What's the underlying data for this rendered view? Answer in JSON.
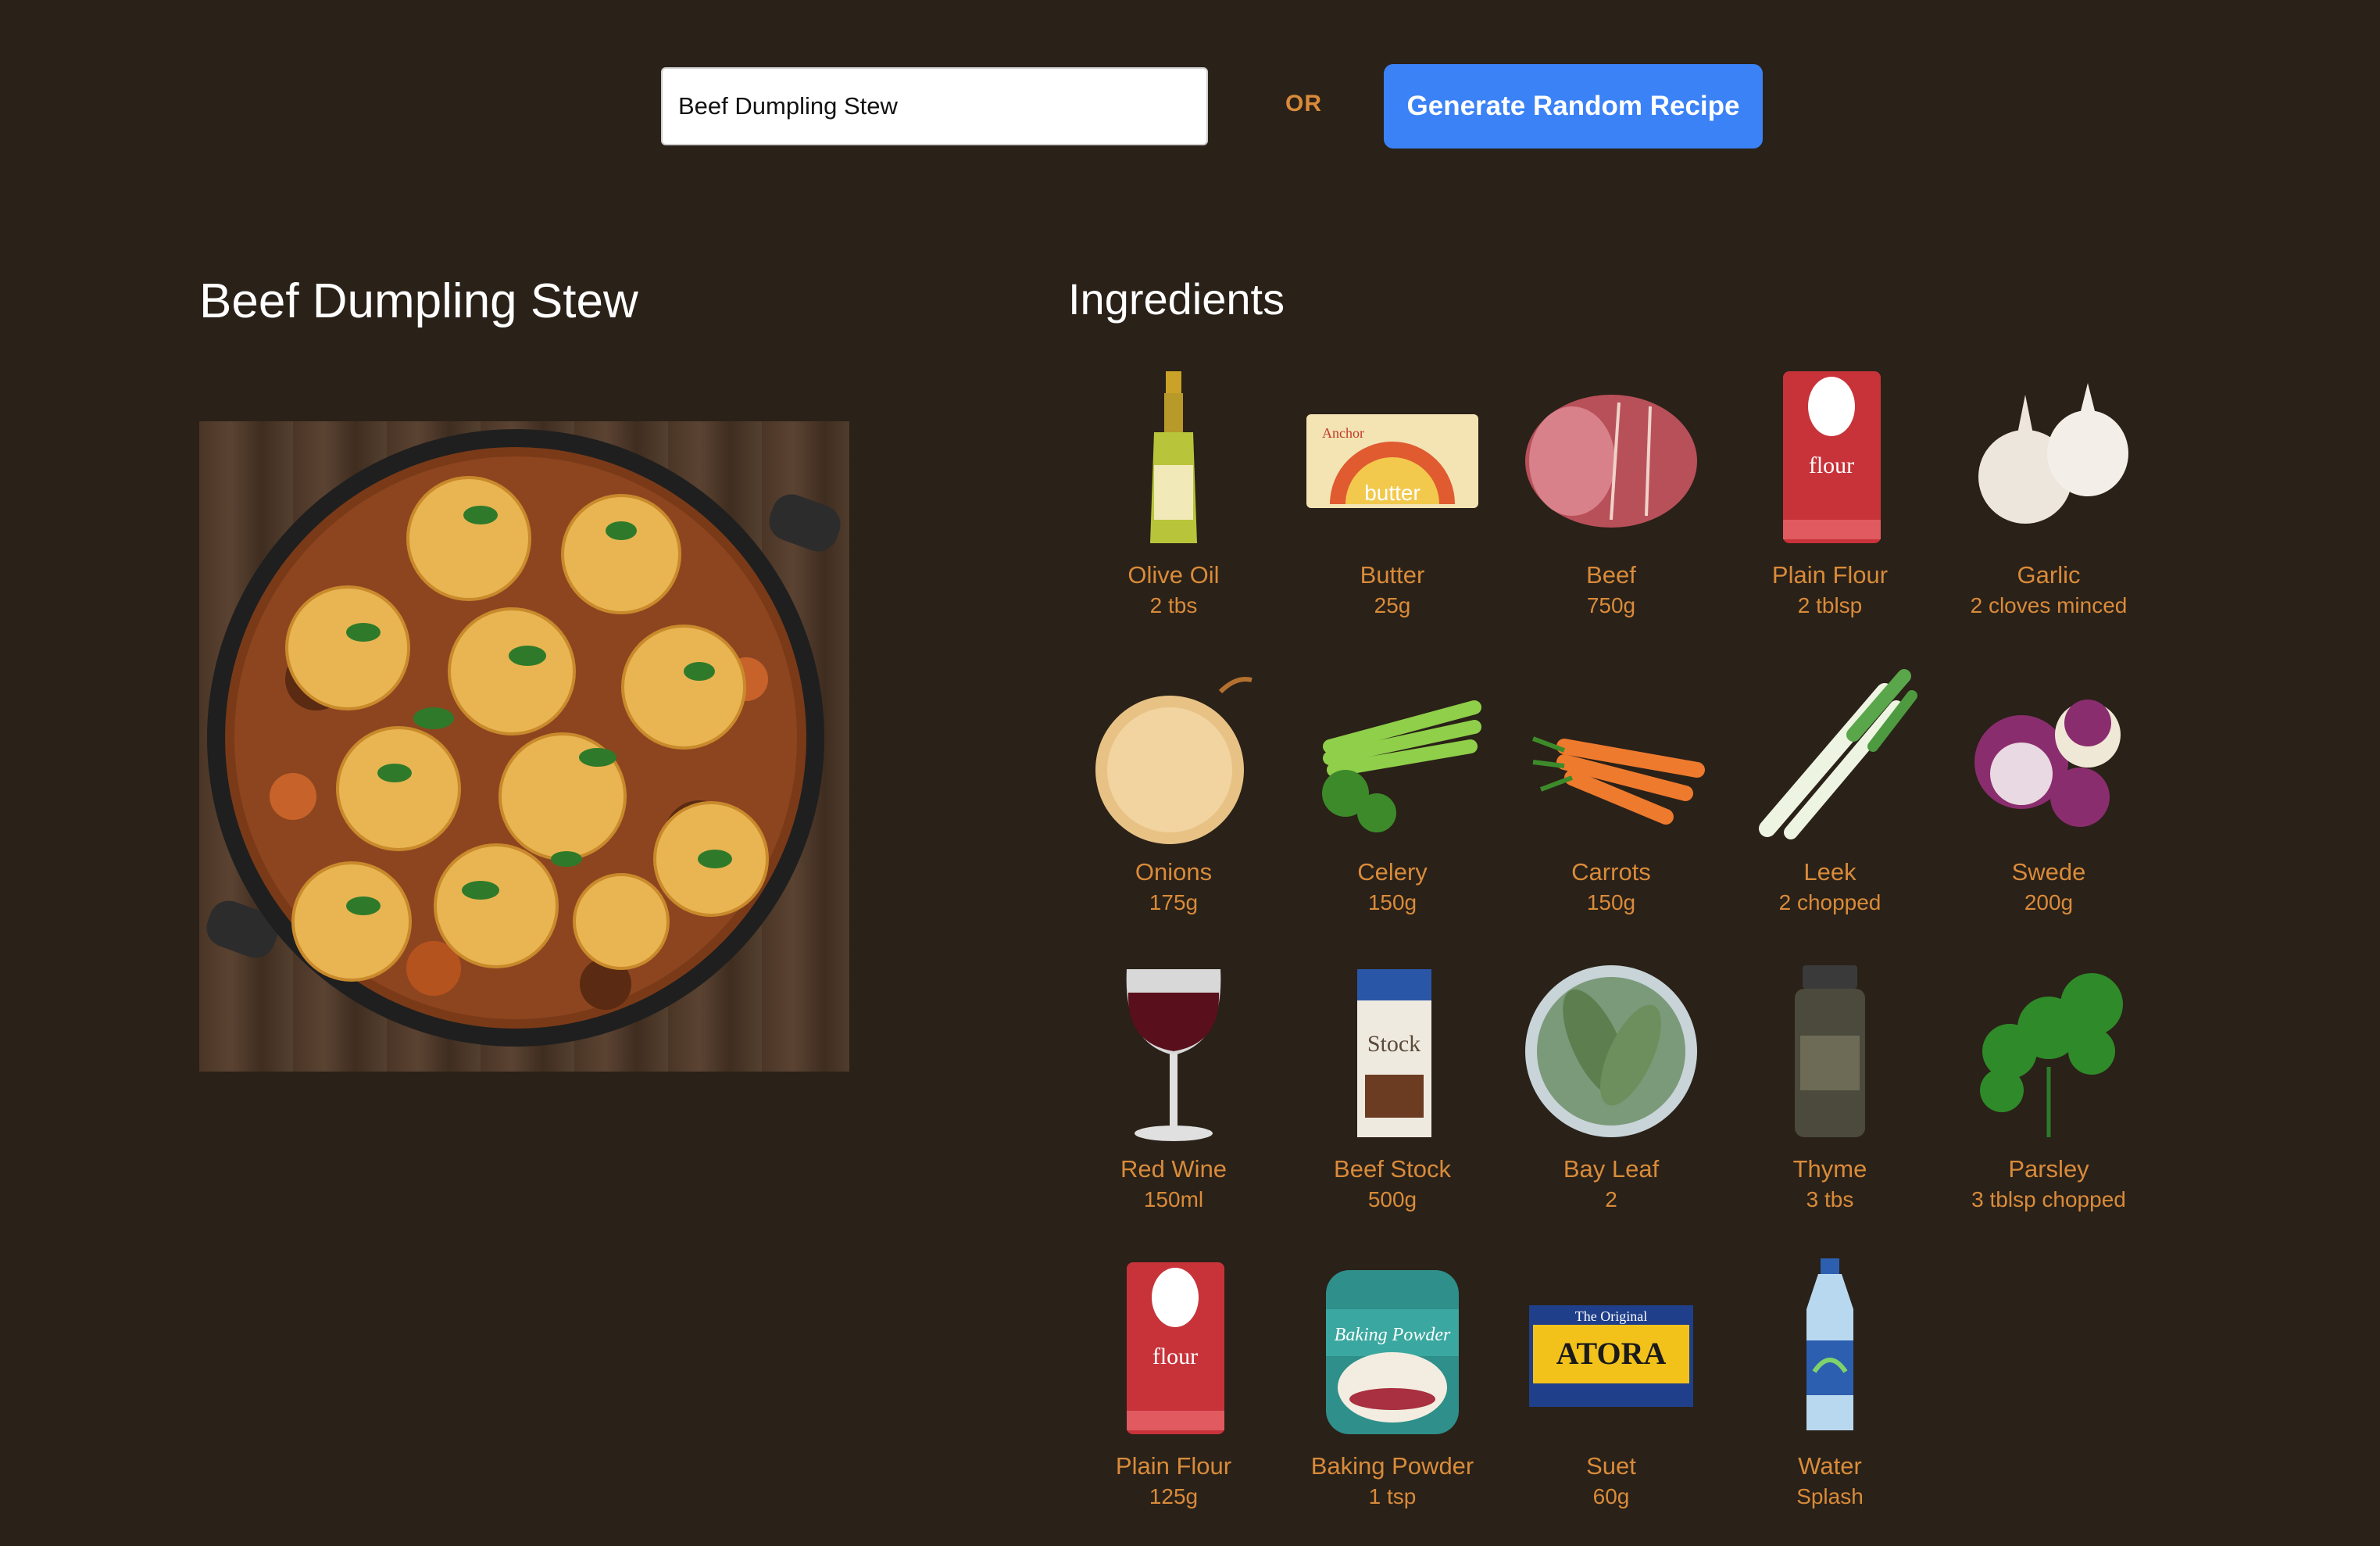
{
  "search": {
    "value": "Beef Dumpling Stew"
  },
  "or_label": "OR",
  "random_button_label": "Generate Random Recipe",
  "recipe": {
    "title": "Beef Dumpling Stew"
  },
  "ingredients_heading": "Ingredients",
  "ingredients": [
    {
      "name": "Olive Oil",
      "qty": "2 tbs",
      "icon": "olive-oil-bottle-icon"
    },
    {
      "name": "Butter",
      "qty": "25g",
      "icon": "butter-pack-icon"
    },
    {
      "name": "Beef",
      "qty": "750g",
      "icon": "beef-joint-icon"
    },
    {
      "name": "Plain Flour",
      "qty": "2 tblsp",
      "icon": "flour-bag-icon"
    },
    {
      "name": "Garlic",
      "qty": "2 cloves minced",
      "icon": "garlic-icon"
    },
    {
      "name": "Onions",
      "qty": "175g",
      "icon": "onion-icon"
    },
    {
      "name": "Celery",
      "qty": "150g",
      "icon": "celery-icon"
    },
    {
      "name": "Carrots",
      "qty": "150g",
      "icon": "carrots-icon"
    },
    {
      "name": "Leek",
      "qty": "2 chopped",
      "icon": "leek-icon"
    },
    {
      "name": "Swede",
      "qty": "200g",
      "icon": "swede-icon"
    },
    {
      "name": "Red Wine",
      "qty": "150ml",
      "icon": "wine-glass-icon"
    },
    {
      "name": "Beef Stock",
      "qty": "500g",
      "icon": "stock-carton-icon"
    },
    {
      "name": "Bay Leaf",
      "qty": "2",
      "icon": "bay-leaf-icon"
    },
    {
      "name": "Thyme",
      "qty": "3 tbs",
      "icon": "thyme-jar-icon"
    },
    {
      "name": "Parsley",
      "qty": "3 tblsp chopped",
      "icon": "parsley-icon"
    },
    {
      "name": "Plain Flour",
      "qty": "125g",
      "icon": "flour-bag-icon"
    },
    {
      "name": "Baking Powder",
      "qty": "1 tsp",
      "icon": "baking-powder-tub-icon"
    },
    {
      "name": "Suet",
      "qty": "60g",
      "icon": "suet-box-icon"
    },
    {
      "name": "Water",
      "qty": "Splash",
      "icon": "water-bottle-icon"
    }
  ],
  "colors": {
    "background": "#2a2118",
    "accent": "#d98b3a",
    "button": "#3b82f6"
  },
  "image_labels": {
    "butter_pack": "butter",
    "butter_brand": "Anchor",
    "flour_bag": "flour",
    "stock_carton": "Stock",
    "baking_powder_tub": "Baking Powder",
    "suet_box_top": "The Original",
    "suet_box_main": "ATORA"
  }
}
